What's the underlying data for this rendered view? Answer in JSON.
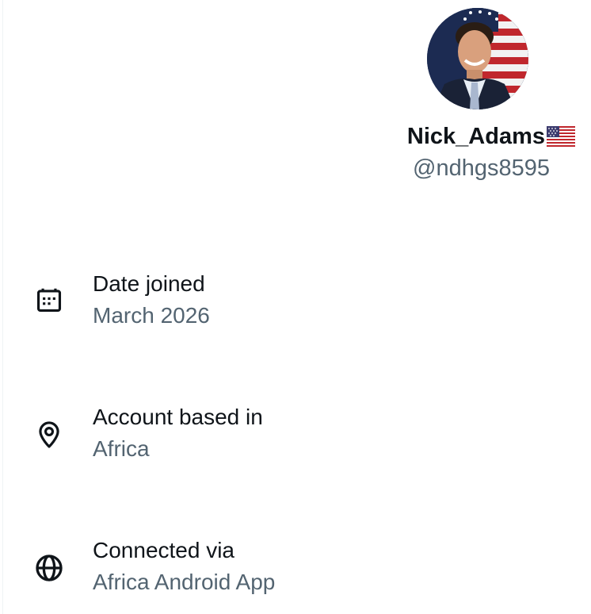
{
  "profile": {
    "display_name": "Nick_Adams",
    "handle": "@ndhgs8595",
    "name_emoji": "us-flag-emoji"
  },
  "info": [
    {
      "icon": "calendar-icon",
      "label": "Date joined",
      "value": "March 2026"
    },
    {
      "icon": "location-pin-icon",
      "label": "Account based in",
      "value": "Africa"
    },
    {
      "icon": "globe-icon",
      "label": "Connected via",
      "value": "Africa Android App"
    }
  ],
  "colors": {
    "primary_text": "#0f1419",
    "secondary_text": "#536471",
    "border": "#eff3f4"
  }
}
